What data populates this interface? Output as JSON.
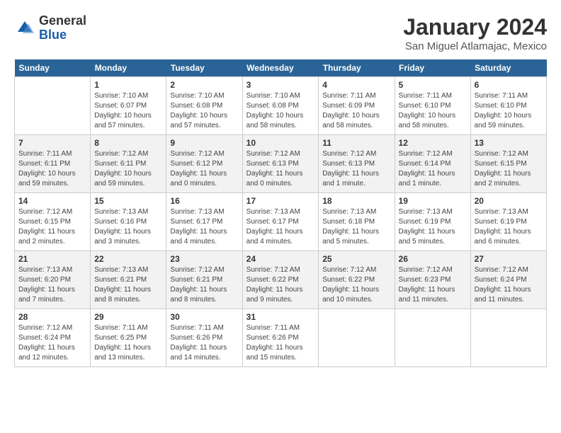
{
  "header": {
    "logo_general": "General",
    "logo_blue": "Blue",
    "title": "January 2024",
    "subtitle": "San Miguel Atlamajac, Mexico"
  },
  "weekdays": [
    "Sunday",
    "Monday",
    "Tuesday",
    "Wednesday",
    "Thursday",
    "Friday",
    "Saturday"
  ],
  "weeks": [
    [
      {
        "day": "",
        "text": ""
      },
      {
        "day": "1",
        "text": "Sunrise: 7:10 AM\nSunset: 6:07 PM\nDaylight: 10 hours\nand 57 minutes."
      },
      {
        "day": "2",
        "text": "Sunrise: 7:10 AM\nSunset: 6:08 PM\nDaylight: 10 hours\nand 57 minutes."
      },
      {
        "day": "3",
        "text": "Sunrise: 7:10 AM\nSunset: 6:08 PM\nDaylight: 10 hours\nand 58 minutes."
      },
      {
        "day": "4",
        "text": "Sunrise: 7:11 AM\nSunset: 6:09 PM\nDaylight: 10 hours\nand 58 minutes."
      },
      {
        "day": "5",
        "text": "Sunrise: 7:11 AM\nSunset: 6:10 PM\nDaylight: 10 hours\nand 58 minutes."
      },
      {
        "day": "6",
        "text": "Sunrise: 7:11 AM\nSunset: 6:10 PM\nDaylight: 10 hours\nand 59 minutes."
      }
    ],
    [
      {
        "day": "7",
        "text": "Sunrise: 7:11 AM\nSunset: 6:11 PM\nDaylight: 10 hours\nand 59 minutes."
      },
      {
        "day": "8",
        "text": "Sunrise: 7:12 AM\nSunset: 6:11 PM\nDaylight: 10 hours\nand 59 minutes."
      },
      {
        "day": "9",
        "text": "Sunrise: 7:12 AM\nSunset: 6:12 PM\nDaylight: 11 hours\nand 0 minutes."
      },
      {
        "day": "10",
        "text": "Sunrise: 7:12 AM\nSunset: 6:13 PM\nDaylight: 11 hours\nand 0 minutes."
      },
      {
        "day": "11",
        "text": "Sunrise: 7:12 AM\nSunset: 6:13 PM\nDaylight: 11 hours\nand 1 minute."
      },
      {
        "day": "12",
        "text": "Sunrise: 7:12 AM\nSunset: 6:14 PM\nDaylight: 11 hours\nand 1 minute."
      },
      {
        "day": "13",
        "text": "Sunrise: 7:12 AM\nSunset: 6:15 PM\nDaylight: 11 hours\nand 2 minutes."
      }
    ],
    [
      {
        "day": "14",
        "text": "Sunrise: 7:12 AM\nSunset: 6:15 PM\nDaylight: 11 hours\nand 2 minutes."
      },
      {
        "day": "15",
        "text": "Sunrise: 7:13 AM\nSunset: 6:16 PM\nDaylight: 11 hours\nand 3 minutes."
      },
      {
        "day": "16",
        "text": "Sunrise: 7:13 AM\nSunset: 6:17 PM\nDaylight: 11 hours\nand 4 minutes."
      },
      {
        "day": "17",
        "text": "Sunrise: 7:13 AM\nSunset: 6:17 PM\nDaylight: 11 hours\nand 4 minutes."
      },
      {
        "day": "18",
        "text": "Sunrise: 7:13 AM\nSunset: 6:18 PM\nDaylight: 11 hours\nand 5 minutes."
      },
      {
        "day": "19",
        "text": "Sunrise: 7:13 AM\nSunset: 6:19 PM\nDaylight: 11 hours\nand 5 minutes."
      },
      {
        "day": "20",
        "text": "Sunrise: 7:13 AM\nSunset: 6:19 PM\nDaylight: 11 hours\nand 6 minutes."
      }
    ],
    [
      {
        "day": "21",
        "text": "Sunrise: 7:13 AM\nSunset: 6:20 PM\nDaylight: 11 hours\nand 7 minutes."
      },
      {
        "day": "22",
        "text": "Sunrise: 7:13 AM\nSunset: 6:21 PM\nDaylight: 11 hours\nand 8 minutes."
      },
      {
        "day": "23",
        "text": "Sunrise: 7:12 AM\nSunset: 6:21 PM\nDaylight: 11 hours\nand 8 minutes."
      },
      {
        "day": "24",
        "text": "Sunrise: 7:12 AM\nSunset: 6:22 PM\nDaylight: 11 hours\nand 9 minutes."
      },
      {
        "day": "25",
        "text": "Sunrise: 7:12 AM\nSunset: 6:22 PM\nDaylight: 11 hours\nand 10 minutes."
      },
      {
        "day": "26",
        "text": "Sunrise: 7:12 AM\nSunset: 6:23 PM\nDaylight: 11 hours\nand 11 minutes."
      },
      {
        "day": "27",
        "text": "Sunrise: 7:12 AM\nSunset: 6:24 PM\nDaylight: 11 hours\nand 11 minutes."
      }
    ],
    [
      {
        "day": "28",
        "text": "Sunrise: 7:12 AM\nSunset: 6:24 PM\nDaylight: 11 hours\nand 12 minutes."
      },
      {
        "day": "29",
        "text": "Sunrise: 7:11 AM\nSunset: 6:25 PM\nDaylight: 11 hours\nand 13 minutes."
      },
      {
        "day": "30",
        "text": "Sunrise: 7:11 AM\nSunset: 6:26 PM\nDaylight: 11 hours\nand 14 minutes."
      },
      {
        "day": "31",
        "text": "Sunrise: 7:11 AM\nSunset: 6:26 PM\nDaylight: 11 hours\nand 15 minutes."
      },
      {
        "day": "",
        "text": ""
      },
      {
        "day": "",
        "text": ""
      },
      {
        "day": "",
        "text": ""
      }
    ]
  ]
}
